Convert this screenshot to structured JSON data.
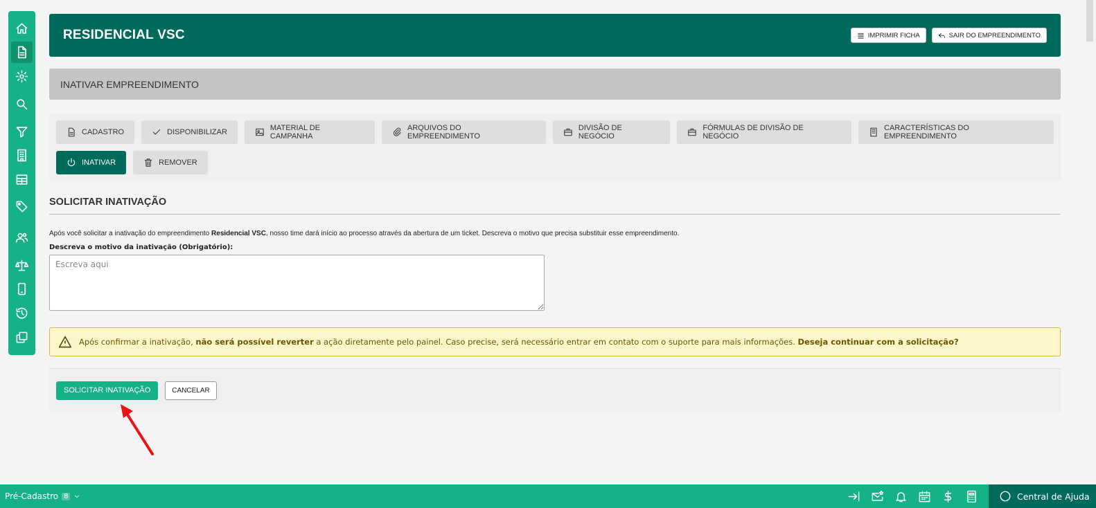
{
  "sidebar": {
    "items": [
      {
        "icon": "home-icon"
      },
      {
        "icon": "document-icon",
        "active": true
      },
      {
        "icon": "gear-icon"
      },
      {
        "icon": "search-icon"
      },
      {
        "icon": "filter-icon"
      },
      {
        "icon": "building-icon"
      },
      {
        "icon": "table-icon"
      },
      {
        "icon": "tag-icon"
      },
      {
        "icon": "users-icon"
      },
      {
        "icon": "scale-icon"
      },
      {
        "icon": "mobile-icon"
      },
      {
        "icon": "history-icon"
      },
      {
        "icon": "copy-icon"
      }
    ]
  },
  "header": {
    "title": "RESIDENCIAL VSC",
    "print_label": "IMPRIMIR FICHA",
    "exit_label": "SAIR DO EMPREENDIMENTO"
  },
  "section": {
    "title": "INATIVAR EMPREENDIMENTO"
  },
  "tabs": {
    "row1": [
      {
        "label": "CADASTRO",
        "icon": "document-icon"
      },
      {
        "label": "DISPONIBILIZAR",
        "icon": "check-icon"
      },
      {
        "label": "MATERIAL DE CAMPANHA",
        "icon": "image-icon"
      },
      {
        "label": "ARQUIVOS DO EMPREENDIMENTO",
        "icon": "paperclip-icon"
      },
      {
        "label": "DIVISÃO DE NEGÓCIO",
        "icon": "briefcase-icon"
      },
      {
        "label": "FÓRMULAS DE DIVISÃO DE NEGÓCIO",
        "icon": "briefcase-icon"
      },
      {
        "label": "CARACTERÍSTICAS DO EMPREENDIMENTO",
        "icon": "building-icon"
      }
    ],
    "row2": [
      {
        "label": "INATIVAR",
        "icon": "power-icon",
        "active": true
      },
      {
        "label": "REMOVER",
        "icon": "trash-icon"
      }
    ]
  },
  "form": {
    "subtitle": "SOLICITAR INATIVAÇÃO",
    "desc_before": "Após você solicitar a inativação do empreendimento ",
    "desc_bold": "Residencial VSC",
    "desc_after": ", nosso time dará início ao processo através da abertura de um ticket. Descreva o motivo que precisa substituir esse empreendimento.",
    "field_label": "Descreva o motivo da inativação (Obrigatório):",
    "placeholder": "Escreva aqui",
    "value": ""
  },
  "warning": {
    "text1": "Após confirmar a inativação, ",
    "bold1": "não será possível reverter",
    "text2": " a ação diretamente pelo painel. Caso precise, será necessário entrar em contato com o suporte para mais informações. ",
    "bold2": "Deseja continuar com a solicitação?",
    "icon": "warning-icon"
  },
  "actions": {
    "submit_label": "SOLICITAR INATIVAÇÃO",
    "cancel_label": "CANCELAR"
  },
  "bottombar": {
    "module_label": "Pré-Cadastro",
    "module_badge": "8",
    "icons": [
      "login-icon",
      "mail-star-icon",
      "bell-icon",
      "calendar-icon",
      "dollar-icon",
      "calculator-icon"
    ],
    "help_label": "Central de Ajuda"
  },
  "colors": {
    "primary": "#006b5b",
    "accent": "#14b286",
    "warning_bg": "#fff7cc",
    "annotation_arrow": "#e8141a"
  }
}
